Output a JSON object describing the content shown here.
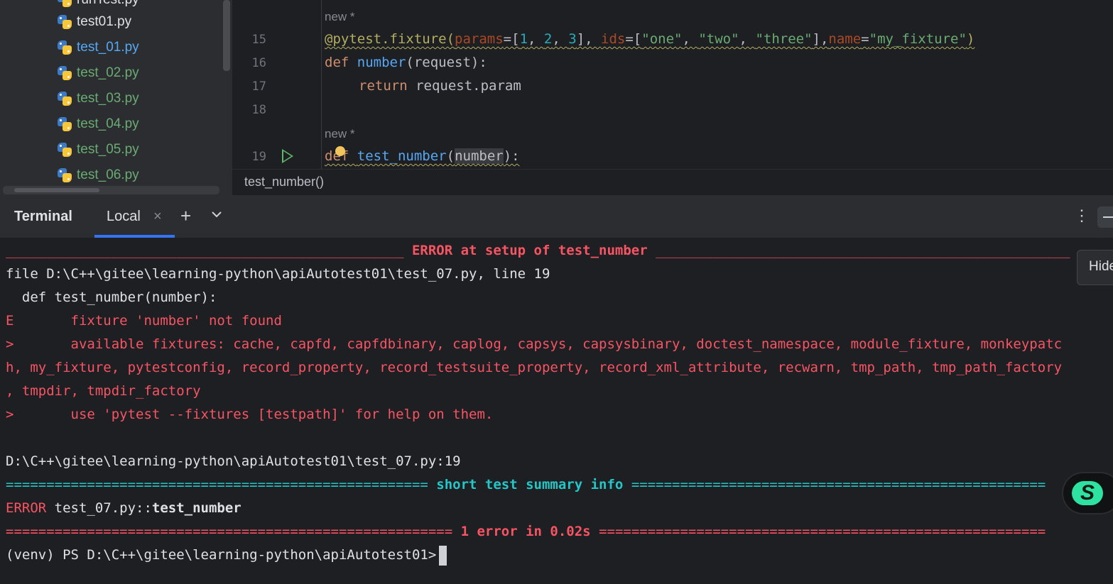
{
  "tree": {
    "files": [
      {
        "name": "runTest.py",
        "color": "white"
      },
      {
        "name": "test01.py",
        "color": "white"
      },
      {
        "name": "test_01.py",
        "color": "blue"
      },
      {
        "name": "test_02.py",
        "color": "green"
      },
      {
        "name": "test_03.py",
        "color": "green"
      },
      {
        "name": "test_04.py",
        "color": "green"
      },
      {
        "name": "test_05.py",
        "color": "green"
      },
      {
        "name": "test_06.py",
        "color": "green"
      }
    ]
  },
  "editor": {
    "hint_new": "new *",
    "line_numbers": {
      "l15": "15",
      "l16": "16",
      "l17": "17",
      "l18": "18",
      "l19": "19"
    },
    "line15": {
      "decorator": "@pytest.fixture(",
      "p_params": "params",
      "eq1": "=[",
      "n1": "1",
      "c1": ", ",
      "n2": "2",
      "c2": ", ",
      "n3": "3",
      "close1": "], ",
      "p_ids": "ids",
      "eq2": "=[",
      "s1": "\"one\"",
      "c3": ", ",
      "s2": "\"two\"",
      "c4": ", ",
      "s3": "\"three\"",
      "close2": "],",
      "p_name": "name",
      "eq3": "=",
      "s4": "\"my_fixture\"",
      "close3": ")"
    },
    "line16": {
      "kw": "def ",
      "fn": "number",
      "rest": "(request):"
    },
    "line17": {
      "kw": "return ",
      "rest": "request.param"
    },
    "line19": {
      "kw": "def ",
      "fn": "test_number",
      "open": "(",
      "arg": "number",
      "close": "):"
    }
  },
  "breadcrumb": {
    "text": "test_number()"
  },
  "terminal_header": {
    "title": "Terminal",
    "tab_label": "Local",
    "close_glyph": "×",
    "plus_glyph": "+",
    "more_glyph": "⋮"
  },
  "tooltip": {
    "text": "Hide"
  },
  "terminal": {
    "l1_left": "_________________________________________________ ",
    "l1_mid": "ERROR at setup of test_number",
    "l1_right": " ___________________________________________________",
    "l2": "file D:\\C++\\gitee\\learning-python\\apiAutotest01\\test_07.py, line 19",
    "l3": "  def test_number(number):",
    "l4": "E       fixture 'number' not found",
    "l5": ">       available fixtures: cache, capfd, capfdbinary, caplog, capsys, capsysbinary, doctest_namespace, module_fixture, monkeypatc",
    "l6": "h, my_fixture, pytestconfig, record_property, record_testsuite_property, record_xml_attribute, recwarn, tmp_path, tmp_path_factory",
    "l7": ", tmpdir, tmpdir_factory",
    "l8": ">       use 'pytest --fixtures [testpath]' for help on them.",
    "l9": "D:\\C++\\gitee\\learning-python\\apiAutotest01\\test_07.py:19",
    "l10_left": "==================================================== ",
    "l10_mid": "short test summary info",
    "l10_right": " ===================================================",
    "l11_err": "ERROR",
    "l11_path": " test_07.py::",
    "l11_name": "test_number",
    "l12_left": "======================================================= ",
    "l12_mid": "1 error in 0.02s",
    "l12_right": " =======================================================",
    "prompt": "(venv) PS D:\\C++\\gitee\\learning-python\\apiAutotest01>"
  },
  "colors": {
    "error_red": "#f75464",
    "summary_cyan": "#24c6c8",
    "accent_blue": "#3574f0"
  }
}
